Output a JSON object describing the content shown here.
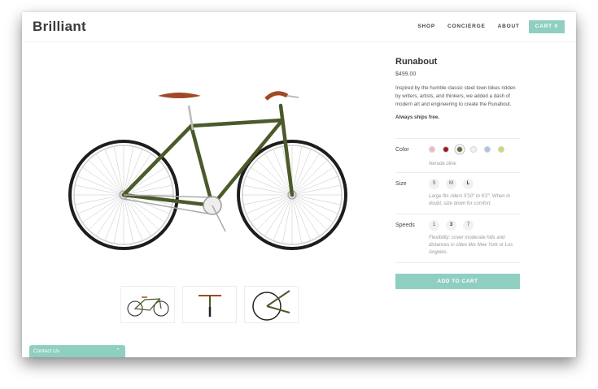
{
  "brand": {
    "logo": "Brilliant"
  },
  "nav": {
    "items": [
      "SHOP",
      "CONCIERGE",
      "ABOUT"
    ],
    "cart_label": "CART",
    "cart_count": "0"
  },
  "product": {
    "title": "Runabout",
    "price": "$499.00",
    "description": "Inspired by the humble classic steel town bikes ridden by writers, artists, and thinkers, we added a dash of modern art and engineering to create the Runabout.",
    "shipping": "Always ships free."
  },
  "options": {
    "color": {
      "label": "Color",
      "swatches": [
        "#f3b9c0",
        "#9b1c25",
        "#6b6b3a",
        "#e9f6f4",
        "#a9c3ec",
        "#c7dc6b"
      ],
      "selected_index": 2,
      "selected_name": "Neruda olive"
    },
    "size": {
      "label": "Size",
      "values": [
        "S",
        "M",
        "L"
      ],
      "selected": "L",
      "note": "Large fits riders 5'10\" to 6'2\". When in doubt, size down for comfort."
    },
    "speeds": {
      "label": "Speeds",
      "values": [
        "1",
        "3",
        "7"
      ],
      "selected": "3",
      "note": "Flexibility: cover moderate hills and distances in cities like New York or Los Angeles."
    }
  },
  "cta": {
    "add_to_cart": "ADD TO CART"
  },
  "contact": {
    "label": "Contact Us"
  },
  "colors": {
    "accent": "#8fcfc1",
    "frame": "#4b5a2a",
    "leather": "#a04a25"
  }
}
